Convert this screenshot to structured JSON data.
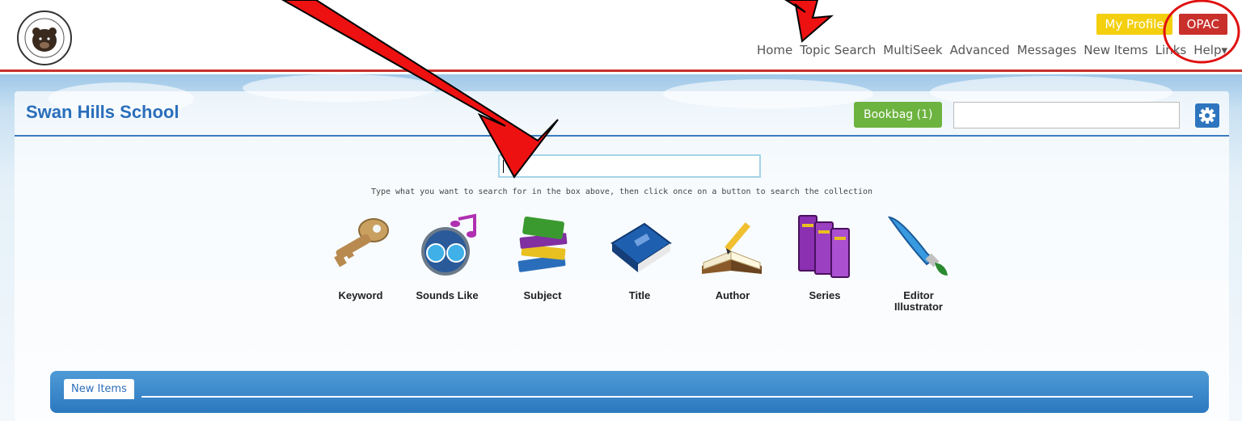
{
  "header": {
    "my_profile": "My Profile",
    "opac": "OPAC",
    "nav": [
      "Home",
      "Topic Search",
      "MultiSeek",
      "Advanced",
      "Messages",
      "New Items",
      "Links",
      "Help▾"
    ]
  },
  "panel": {
    "school_name": "Swan Hills School",
    "bookbag": "Bookbag (1)",
    "quick_search_value": "",
    "search_value": "",
    "hint": "Type what you want to search for in the box above, then click once on a button to search the collection"
  },
  "search_buttons": [
    {
      "label": "Keyword",
      "icon": "key-icon"
    },
    {
      "label": "Sounds Like",
      "icon": "sounds-like-icon"
    },
    {
      "label": "Subject",
      "icon": "books-stack-icon"
    },
    {
      "label": "Title",
      "icon": "blue-book-icon"
    },
    {
      "label": "Author",
      "icon": "open-book-pencil-icon"
    },
    {
      "label": "Series",
      "icon": "book-series-icon"
    },
    {
      "label": "Editor Illustrator",
      "icon": "paintbrush-icon"
    }
  ],
  "new_items": {
    "tab": "New Items"
  },
  "colors": {
    "accent_red": "#c9302c",
    "brand_blue": "#2a6ebb",
    "bookbag_green": "#6db33f",
    "profile_yellow": "#f3cf0e"
  }
}
